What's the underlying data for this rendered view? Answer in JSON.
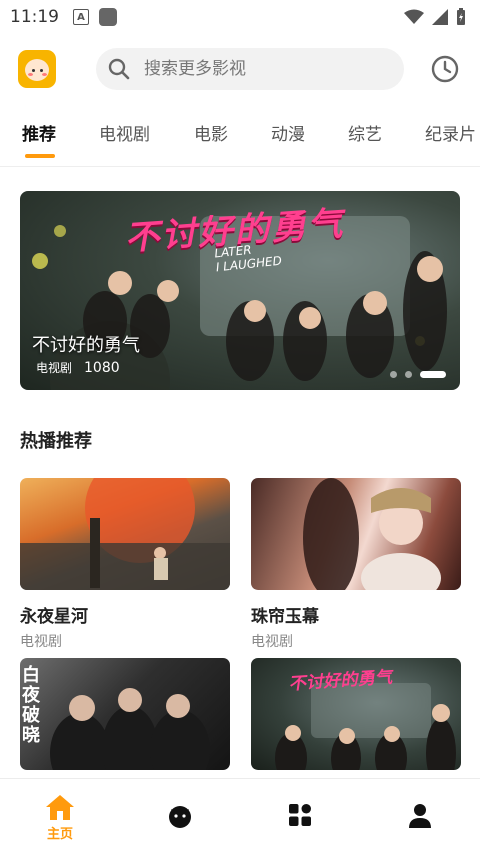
{
  "status_bar": {
    "time": "11:19",
    "notif_letter": "A"
  },
  "header": {
    "search_placeholder": "搜索更多影视"
  },
  "tabs": [
    {
      "label": "推荐",
      "active": true
    },
    {
      "label": "电视剧",
      "active": false
    },
    {
      "label": "电影",
      "active": false
    },
    {
      "label": "动漫",
      "active": false
    },
    {
      "label": "综艺",
      "active": false
    },
    {
      "label": "纪录片",
      "active": false
    }
  ],
  "banner": {
    "title": "不讨好的勇气",
    "category": "电视剧",
    "quality": "1080",
    "art_title": "不讨好的勇气",
    "art_subtitle_line1": "LATER",
    "art_subtitle_line2": "I LAUGHED",
    "slide_count": 3,
    "active_slide": 3
  },
  "section": {
    "title": "热播推荐"
  },
  "cards": [
    {
      "title": "永夜星河",
      "category": "电视剧"
    },
    {
      "title": "珠帘玉幕",
      "category": "电视剧"
    },
    {
      "title": "",
      "category": "",
      "art_text": "白夜破晓"
    },
    {
      "title": "",
      "category": "",
      "art_text": "不讨好的勇气"
    }
  ],
  "bottom_nav": [
    {
      "label": "主页",
      "icon": "home-icon",
      "active": true
    },
    {
      "label": "",
      "icon": "mascot-icon",
      "active": false
    },
    {
      "label": "",
      "icon": "grid-icon",
      "active": false
    },
    {
      "label": "",
      "icon": "user-icon",
      "active": false
    }
  ],
  "colors": {
    "accent": "#ff9a0d",
    "text": "#222222",
    "muted": "#888888",
    "search_bg": "#f2f2f2"
  }
}
